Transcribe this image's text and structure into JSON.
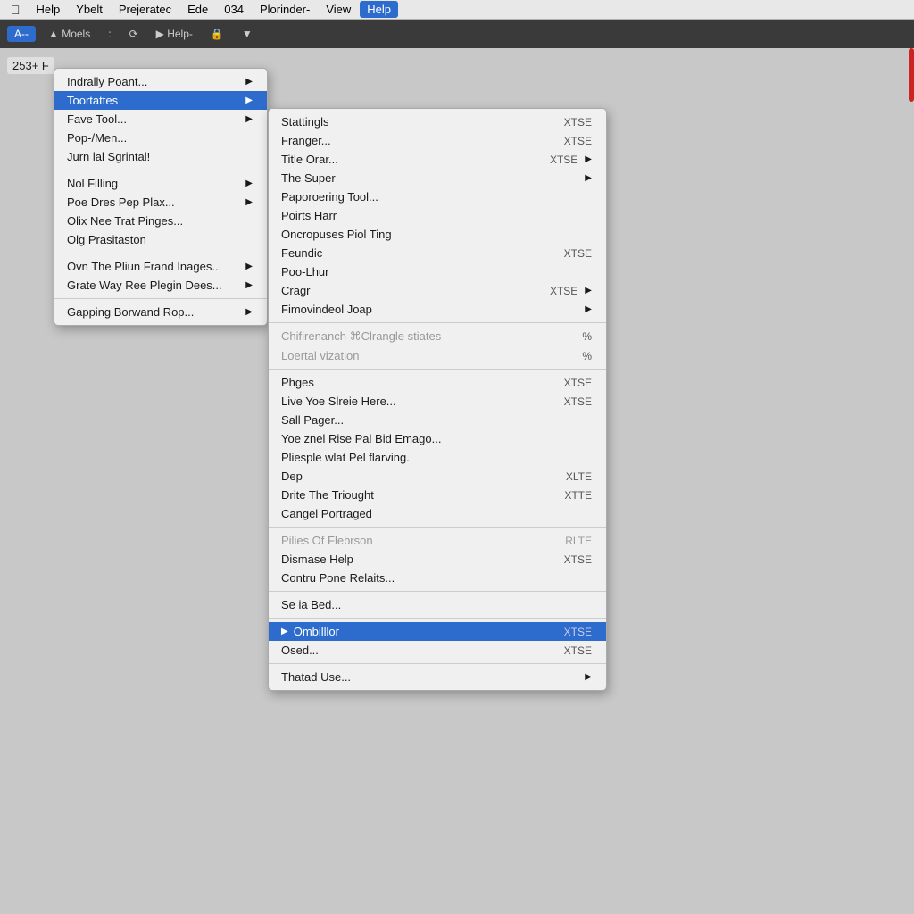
{
  "menubar": {
    "apple_label": "",
    "items": [
      {
        "label": "Help",
        "active": true
      },
      {
        "label": "Ybelt",
        "active": false
      },
      {
        "label": "Prejeratec",
        "active": false
      },
      {
        "label": "Ede",
        "active": false
      },
      {
        "label": "034",
        "active": false
      },
      {
        "label": "Plorinder-",
        "active": false
      },
      {
        "label": "View",
        "active": false
      },
      {
        "label": "Help",
        "active": false
      }
    ]
  },
  "toolbar": {
    "label": "A--",
    "items": [
      "▲ Moels",
      ":",
      "🔄",
      "▶ Help-",
      "🔒",
      "▼"
    ]
  },
  "primary_menu": {
    "items": [
      {
        "label": "Indrally Poant...",
        "shortcut": "",
        "arrow": true,
        "separator_after": false,
        "disabled": false
      },
      {
        "label": "Toortattes",
        "shortcut": "",
        "arrow": true,
        "separator_after": false,
        "disabled": false,
        "highlighted": true
      },
      {
        "label": "Fave Tool...",
        "shortcut": "",
        "arrow": true,
        "separator_after": false,
        "disabled": false
      },
      {
        "label": "Pop-/Men...",
        "shortcut": "",
        "arrow": false,
        "separator_after": false,
        "disabled": false
      },
      {
        "label": "Jurn lal Sgrintal!",
        "shortcut": "",
        "arrow": false,
        "separator_after": true,
        "disabled": false
      },
      {
        "label": "Nol Filling",
        "shortcut": "",
        "arrow": true,
        "separator_after": false,
        "disabled": false
      },
      {
        "label": "Poe Dres Pep Plax...",
        "shortcut": "",
        "arrow": true,
        "separator_after": false,
        "disabled": false
      },
      {
        "label": "Olix Nee Trat Pinges...",
        "shortcut": "",
        "arrow": false,
        "separator_after": false,
        "disabled": false
      },
      {
        "label": "Olg Prasitaston",
        "shortcut": "",
        "arrow": false,
        "separator_after": true,
        "disabled": false
      },
      {
        "label": "Ovn The Pliun Frand Inages...",
        "shortcut": "",
        "arrow": true,
        "separator_after": false,
        "disabled": false
      },
      {
        "label": "Grate Way Ree Plegin Dees...",
        "shortcut": "",
        "arrow": true,
        "separator_after": true,
        "disabled": false
      },
      {
        "label": "Gapping Borwand Rop...",
        "shortcut": "",
        "arrow": true,
        "separator_after": false,
        "disabled": false
      }
    ]
  },
  "secondary_menu": {
    "items": [
      {
        "label": "Stattingls",
        "shortcut": "XTSE",
        "arrow": false,
        "separator_after": false,
        "disabled": false,
        "highlighted": false
      },
      {
        "label": "Franger...",
        "shortcut": "XTSE",
        "arrow": false,
        "separator_after": false,
        "disabled": false,
        "highlighted": false
      },
      {
        "label": "Title Orar...",
        "shortcut": "XTSE",
        "arrow": true,
        "separator_after": false,
        "disabled": false,
        "highlighted": false
      },
      {
        "label": "The Super",
        "shortcut": "",
        "arrow": true,
        "separator_after": false,
        "disabled": false,
        "highlighted": false
      },
      {
        "label": "Paporoering Tool...",
        "shortcut": "",
        "arrow": false,
        "separator_after": false,
        "disabled": false,
        "highlighted": false
      },
      {
        "label": "Poirts Harr",
        "shortcut": "",
        "arrow": false,
        "separator_after": false,
        "disabled": false,
        "highlighted": false
      },
      {
        "label": "Oncropuses Piol Ting",
        "shortcut": "",
        "arrow": false,
        "separator_after": false,
        "disabled": false,
        "highlighted": false
      },
      {
        "label": "Feundic",
        "shortcut": "XTSE",
        "arrow": false,
        "separator_after": false,
        "disabled": false,
        "highlighted": false
      },
      {
        "label": "Poo-Lhur",
        "shortcut": "",
        "arrow": false,
        "separator_after": false,
        "disabled": false,
        "highlighted": false
      },
      {
        "label": "Cragr",
        "shortcut": "XTSE",
        "arrow": true,
        "separator_after": false,
        "disabled": false,
        "highlighted": false
      },
      {
        "label": "Fimovindeol Joap",
        "shortcut": "",
        "arrow": true,
        "separator_after": true,
        "disabled": false,
        "highlighted": false
      },
      {
        "label": "Chifirenanch ⌘Clrangle stiates",
        "shortcut": "%",
        "arrow": false,
        "separator_after": false,
        "disabled": true,
        "highlighted": false
      },
      {
        "label": "Loertal vization",
        "shortcut": "%",
        "arrow": false,
        "separator_after": true,
        "disabled": true,
        "highlighted": false
      },
      {
        "label": "Phges",
        "shortcut": "XTSE",
        "arrow": false,
        "separator_after": false,
        "disabled": false,
        "highlighted": false
      },
      {
        "label": "Live Yoe Slreie Here...",
        "shortcut": "XTSE",
        "arrow": false,
        "separator_after": false,
        "disabled": false,
        "highlighted": false
      },
      {
        "label": "Sall Pager...",
        "shortcut": "",
        "arrow": false,
        "separator_after": false,
        "disabled": false,
        "highlighted": false
      },
      {
        "label": "Yoe znel Rise Pal Bid Emago...",
        "shortcut": "",
        "arrow": false,
        "separator_after": false,
        "disabled": false,
        "highlighted": false
      },
      {
        "label": "Pliesple wlat Pel flarving.",
        "shortcut": "",
        "arrow": false,
        "separator_after": false,
        "disabled": false,
        "highlighted": false
      },
      {
        "label": "Dep",
        "shortcut": "XLTE",
        "arrow": false,
        "separator_after": false,
        "disabled": false,
        "highlighted": false
      },
      {
        "label": "Drite The Triought",
        "shortcut": "XTTE",
        "arrow": false,
        "separator_after": false,
        "disabled": false,
        "highlighted": false
      },
      {
        "label": "Cangel Portraged",
        "shortcut": "",
        "arrow": false,
        "separator_after": true,
        "disabled": false,
        "highlighted": false
      },
      {
        "label": "Pilies Of Flebrson",
        "shortcut": "RLTE",
        "arrow": false,
        "separator_after": false,
        "disabled": true,
        "highlighted": false
      },
      {
        "label": "Dismase Help",
        "shortcut": "XTSE",
        "arrow": false,
        "separator_after": false,
        "disabled": false,
        "highlighted": false
      },
      {
        "label": "Contru Pone Relaits...",
        "shortcut": "",
        "arrow": false,
        "separator_after": true,
        "disabled": false,
        "highlighted": false
      },
      {
        "label": "Se ia Bed...",
        "shortcut": "",
        "arrow": false,
        "separator_after": true,
        "disabled": false,
        "highlighted": false
      },
      {
        "label": "Ombilllor",
        "shortcut": "XTSE",
        "arrow": false,
        "separator_after": false,
        "disabled": false,
        "highlighted": true,
        "bullet": true
      },
      {
        "label": "Osed...",
        "shortcut": "XTSE",
        "arrow": false,
        "separator_after": true,
        "disabled": false,
        "highlighted": false
      },
      {
        "label": "Thatad Use...",
        "shortcut": "",
        "arrow": true,
        "separator_after": false,
        "disabled": false,
        "highlighted": false
      }
    ]
  },
  "status_bar": {
    "label": "253+ F"
  }
}
